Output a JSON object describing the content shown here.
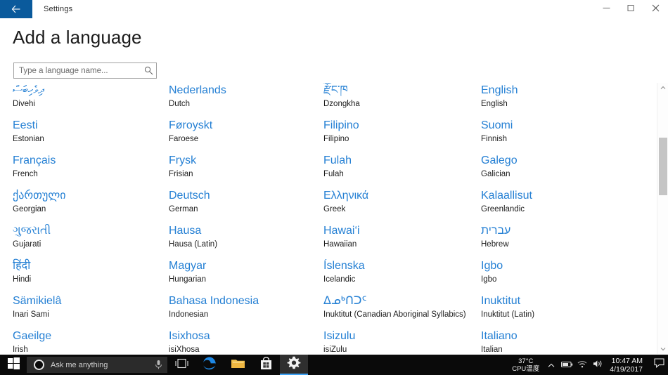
{
  "titlebar": {
    "app_title": "Settings",
    "back_icon": "back-arrow-icon",
    "minimize_label": "–",
    "maximize_label": "⬜",
    "close_label": "✕"
  },
  "page": {
    "title": "Add a language"
  },
  "search": {
    "placeholder": "Type a language name...",
    "value": "",
    "icon": "search-icon"
  },
  "colors": {
    "accent_blue": "#2580d4",
    "titlebar_accent": "#0a5a9c",
    "taskbar": "#0a0a0a",
    "active_tab_underline": "#3da2f5"
  },
  "languages": [
    {
      "native": "ދިވެހިބަސް",
      "english": "Divehi",
      "rtl": true
    },
    {
      "native": "Nederlands",
      "english": "Dutch",
      "rtl": false
    },
    {
      "native": "རྫོང་ཁ",
      "english": "Dzongkha",
      "rtl": false
    },
    {
      "native": "English",
      "english": "English",
      "rtl": false
    },
    {
      "native": "Eesti",
      "english": "Estonian",
      "rtl": false
    },
    {
      "native": "Føroyskt",
      "english": "Faroese",
      "rtl": false
    },
    {
      "native": "Filipino",
      "english": "Filipino",
      "rtl": false
    },
    {
      "native": "Suomi",
      "english": "Finnish",
      "rtl": false
    },
    {
      "native": "Français",
      "english": "French",
      "rtl": false
    },
    {
      "native": "Frysk",
      "english": "Frisian",
      "rtl": false
    },
    {
      "native": "Fulah",
      "english": "Fulah",
      "rtl": false
    },
    {
      "native": "Galego",
      "english": "Galician",
      "rtl": false
    },
    {
      "native": "ქართული",
      "english": "Georgian",
      "rtl": false
    },
    {
      "native": "Deutsch",
      "english": "German",
      "rtl": false
    },
    {
      "native": "Ελληνικά",
      "english": "Greek",
      "rtl": false
    },
    {
      "native": "Kalaallisut",
      "english": "Greenlandic",
      "rtl": false
    },
    {
      "native": "ગુજરાતી",
      "english": "Gujarati",
      "rtl": false
    },
    {
      "native": "Hausa",
      "english": "Hausa (Latin)",
      "rtl": false
    },
    {
      "native": "Hawai‘i",
      "english": "Hawaiian",
      "rtl": false
    },
    {
      "native": "עברית",
      "english": "Hebrew",
      "rtl": true
    },
    {
      "native": "हिंदी",
      "english": "Hindi",
      "rtl": false
    },
    {
      "native": "Magyar",
      "english": "Hungarian",
      "rtl": false
    },
    {
      "native": "Íslenska",
      "english": "Icelandic",
      "rtl": false
    },
    {
      "native": "Igbo",
      "english": "Igbo",
      "rtl": false
    },
    {
      "native": "Sämikielâ",
      "english": "Inari Sami",
      "rtl": false
    },
    {
      "native": "Bahasa Indonesia",
      "english": "Indonesian",
      "rtl": false
    },
    {
      "native": "ᐃᓄᒃᑎᑐᑦ",
      "english": "Inuktitut (Canadian Aboriginal Syllabics)",
      "rtl": false
    },
    {
      "native": "Inuktitut",
      "english": "Inuktitut (Latin)",
      "rtl": false
    },
    {
      "native": "Gaeilge",
      "english": "Irish",
      "rtl": false
    },
    {
      "native": "Isixhosa",
      "english": "isiXhosa",
      "rtl": false
    },
    {
      "native": "Isizulu",
      "english": "isiZulu",
      "rtl": false
    },
    {
      "native": "Italiano",
      "english": "Italian",
      "rtl": false
    }
  ],
  "taskbar": {
    "start_icon": "windows-start-icon",
    "cortana": {
      "placeholder": "Ask me anything",
      "circle_icon": "cortana-circle-icon",
      "mic_icon": "microphone-icon"
    },
    "apps": [
      {
        "name": "task-view-icon",
        "label": "Task View",
        "active": false
      },
      {
        "name": "edge-icon",
        "label": "Microsoft Edge",
        "active": false
      },
      {
        "name": "file-explorer-icon",
        "label": "File Explorer",
        "active": false
      },
      {
        "name": "microsoft-store-icon",
        "label": "Microsoft Store",
        "active": false
      },
      {
        "name": "settings-icon",
        "label": "Settings",
        "active": true
      }
    ],
    "tray": {
      "cpu_temp_value": "37°C",
      "cpu_temp_label": "CPU温度",
      "show_hidden_icon": "chevron-up-icon",
      "battery_icon": "battery-icon",
      "network_icon": "wifi-icon",
      "volume_icon": "speaker-icon",
      "time": "10:47 AM",
      "date": "4/19/2017",
      "action_center_icon": "action-center-icon"
    }
  }
}
